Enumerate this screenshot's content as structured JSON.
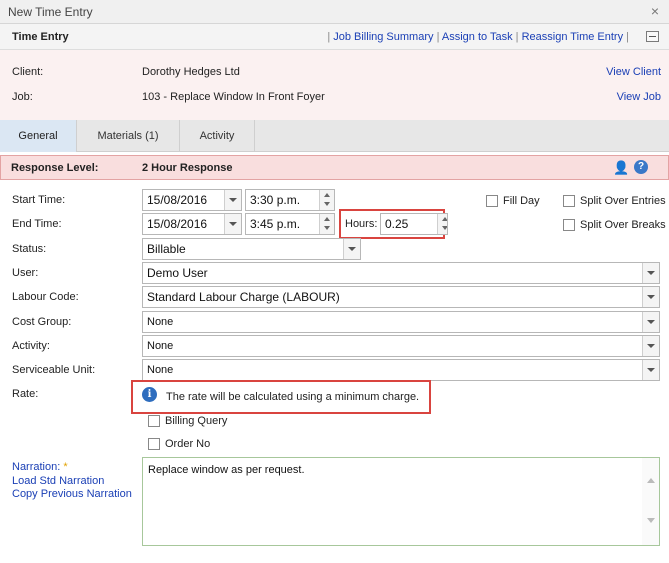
{
  "window": {
    "title": "New Time Entry",
    "close_glyph": "×"
  },
  "header": {
    "title": "Time Entry",
    "sep": "|",
    "links": [
      "Job Billing Summary",
      "Assign to Task",
      "Reassign Time Entry"
    ]
  },
  "client_panel": {
    "client_label": "Client:",
    "client_value": "Dorothy Hedges Ltd",
    "view_client": "View Client",
    "job_label": "Job:",
    "job_value": "103 - Replace Window In Front Foyer",
    "view_job": "View Job"
  },
  "tabs": [
    "General",
    "Materials (1)",
    "Activity"
  ],
  "response": {
    "label": "Response Level:",
    "value": "2 Hour Response",
    "help_glyph": "?",
    "person_icon_glyph": "👤"
  },
  "form": {
    "start_label": "Start Time:",
    "start_date": "15/08/2016",
    "start_time": "3:30 p.m.",
    "end_label": "End Time:",
    "end_date": "15/08/2016",
    "end_time": "3:45 p.m.",
    "hours_label": "Hours:",
    "hours_value": "0.25",
    "fill_day": "Fill Day",
    "split_entries": "Split Over Entries",
    "split_breaks": "Split Over Breaks",
    "status_label": "Status:",
    "status_value": "Billable",
    "user_label": "User:",
    "user_value": "Demo User",
    "labour_label": "Labour Code:",
    "labour_value": "Standard Labour Charge (LABOUR)",
    "cost_label": "Cost Group:",
    "cost_value": "None",
    "activity_label": "Activity:",
    "activity_value": "None",
    "unit_label": "Serviceable Unit:",
    "unit_value": "None",
    "rate_label": "Rate:",
    "rate_message": "The rate will be calculated using a minimum charge.",
    "info_glyph": "i",
    "billing_query": "Billing Query",
    "order_no": "Order No",
    "narration_label": "Narration:",
    "narration_star": "*",
    "load_std": "Load Std Narration",
    "copy_prev": "Copy Previous Narration",
    "narration_text": "Replace window as per request."
  },
  "colors": {
    "highlight": "#d9443f",
    "link": "#1a3fb5",
    "response_bg": "#f9dede"
  }
}
